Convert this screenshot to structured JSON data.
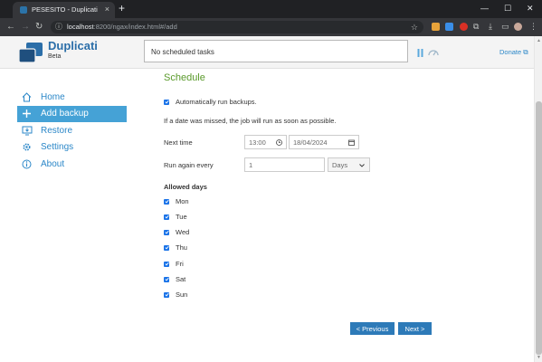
{
  "browser": {
    "tab_title": "PESESITO - Duplicati",
    "tab_close": "×",
    "new_tab": "+",
    "url_host": "localhost",
    "url_path": ":8200/ngax/index.html#/add",
    "window": {
      "minimize": "—",
      "maximize": "☐",
      "close": "✕"
    },
    "nav": {
      "back": "←",
      "forward": "→",
      "reload": "↻"
    },
    "icons": {
      "info": "ⓘ",
      "star": "☆",
      "download": "⤓",
      "puzzle": "⧉",
      "sidebar": "▭",
      "menu": "⋮"
    }
  },
  "header": {
    "logo_name": "Duplicati",
    "logo_sub": "Beta",
    "status_text": "No scheduled tasks",
    "donate_label": "Donate",
    "donate_icon": "⧉"
  },
  "sidebar": {
    "items": [
      {
        "label": "Home",
        "icon": "home-icon",
        "active": false
      },
      {
        "label": "Add backup",
        "icon": "plus-icon",
        "active": true
      },
      {
        "label": "Restore",
        "icon": "restore-icon",
        "active": false
      },
      {
        "label": "Settings",
        "icon": "gear-icon",
        "active": false
      },
      {
        "label": "About",
        "icon": "info-icon",
        "active": false
      }
    ]
  },
  "schedule": {
    "title": "Schedule",
    "auto_run_label": "Automatically run backups.",
    "auto_run_checked": true,
    "missed_note": "If a date was missed, the job will run as soon as possible.",
    "next_time_label": "Next time",
    "next_time_time": "13:00",
    "next_time_date": "18/04/2024",
    "run_again_label": "Run again every",
    "run_again_value": "1",
    "run_again_unit": "Days",
    "allowed_days_label": "Allowed days",
    "days": [
      {
        "label": "Mon",
        "checked": true
      },
      {
        "label": "Tue",
        "checked": true
      },
      {
        "label": "Wed",
        "checked": true
      },
      {
        "label": "Thu",
        "checked": true
      },
      {
        "label": "Fri",
        "checked": true
      },
      {
        "label": "Sat",
        "checked": true
      },
      {
        "label": "Sun",
        "checked": true
      }
    ]
  },
  "actions": {
    "previous_label": "< Previous",
    "next_label": "Next >"
  },
  "colors": {
    "brand": "#2b6ea8",
    "link": "#2b87c8",
    "active_nav": "#45a2d6",
    "section_title": "#5a9a2b",
    "button": "#2d7ab8",
    "checkbox": "#1a73e8"
  }
}
